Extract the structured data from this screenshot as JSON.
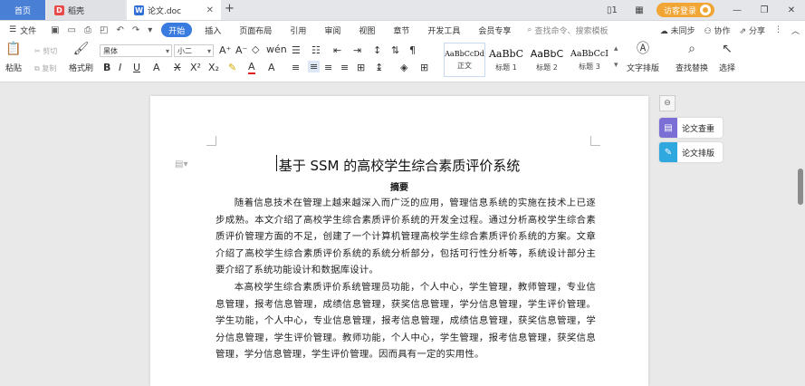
{
  "tabs": {
    "home": "首页",
    "daoke": "稻壳",
    "doc": "论文.doc"
  },
  "titlebar": {
    "login": "访客登录"
  },
  "menubar": {
    "file": "文件",
    "items": [
      "开始",
      "插入",
      "页面布局",
      "引用",
      "审阅",
      "视图",
      "章节",
      "开发工具",
      "会员专享"
    ],
    "search_placeholder": "查找命令、搜索模板",
    "sync": "未同步",
    "collab": "协作",
    "share": "分享"
  },
  "ribbon": {
    "paste": "粘贴",
    "cut": "剪切",
    "copy": "复制",
    "format_painter": "格式刷",
    "font_name": "黑体",
    "font_size": "小二",
    "styles": [
      {
        "sample": "AaBbCcDd",
        "label": "正文"
      },
      {
        "sample": "AaBbC",
        "label": "标题 1"
      },
      {
        "sample": "AaBbC",
        "label": "标题 2"
      },
      {
        "sample": "AaBbCcI",
        "label": "标题 3"
      }
    ],
    "text_layout": "文字排版",
    "find_replace": "查找替换",
    "select": "选择"
  },
  "document": {
    "title": "基于 SSM 的高校学生综合素质评价系统",
    "abstract_heading": "摘要",
    "para1": "随着信息技术在管理上越来越深入而广泛的应用，管理信息系统的实施在技术上已逐步成熟。本文介绍了高校学生综合素质评价系统的开发全过程。通过分析高校学生综合素质评价管理方面的不足，创建了一个计算机管理高校学生综合素质评价系统的方案。文章介绍了高校学生综合素质评价系统的系统分析部分，包括可行性分析等，系统设计部分主要介绍了系统功能设计和数据库设计。",
    "para2": "本高校学生综合素质评价系统管理员功能，个人中心，学生管理，教师管理，专业信息管理，报考信息管理，成绩信息管理，获奖信息管理，学分信息管理，学生评价管理。学生功能，个人中心，专业信息管理，报考信息管理，成绩信息管理，获奖信息管理，学分信息管理，学生评价管理。教师功能，个人中心，学生管理，报考信息管理，获奖信息管理，学分信息管理，学生评价管理。因而具有一定的实用性。"
  },
  "side_panel": {
    "check": "论文查重",
    "layout": "论文排版"
  }
}
